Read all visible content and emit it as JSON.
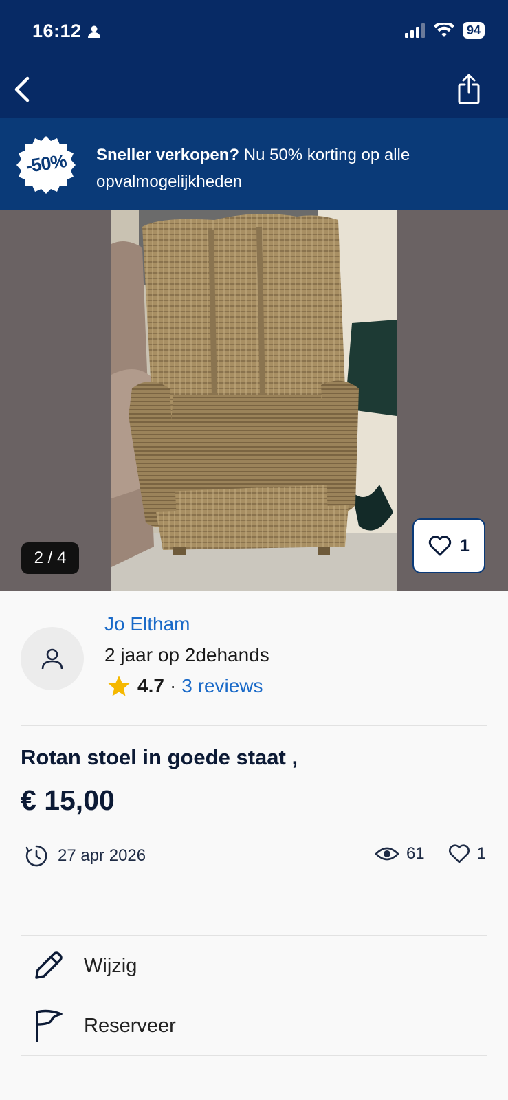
{
  "status_bar": {
    "time": "16:12",
    "battery": "94"
  },
  "promo": {
    "badge": "-50%",
    "bold": "Sneller verkopen?",
    "text": " Nu 50% korting op alle opvalmogelijkheden"
  },
  "gallery": {
    "counter": "2 / 4",
    "favorites_count": "1"
  },
  "seller": {
    "name": "Jo Eltham",
    "since": "2 jaar op 2dehands",
    "rating": "4.7",
    "separator": "·",
    "reviews": "3 reviews"
  },
  "listing": {
    "title": "Rotan stoel in goede staat ,",
    "price": "€ 15,00",
    "date": "27 apr 2026",
    "views": "61",
    "likes": "1"
  },
  "actions": {
    "edit_label": "Wijzig",
    "reserve_label": "Reserveer"
  },
  "colors": {
    "header_bg": "#072a65",
    "promo_bg": "#0a3a78",
    "link": "#1a6ac8",
    "star": "#f5b800"
  }
}
